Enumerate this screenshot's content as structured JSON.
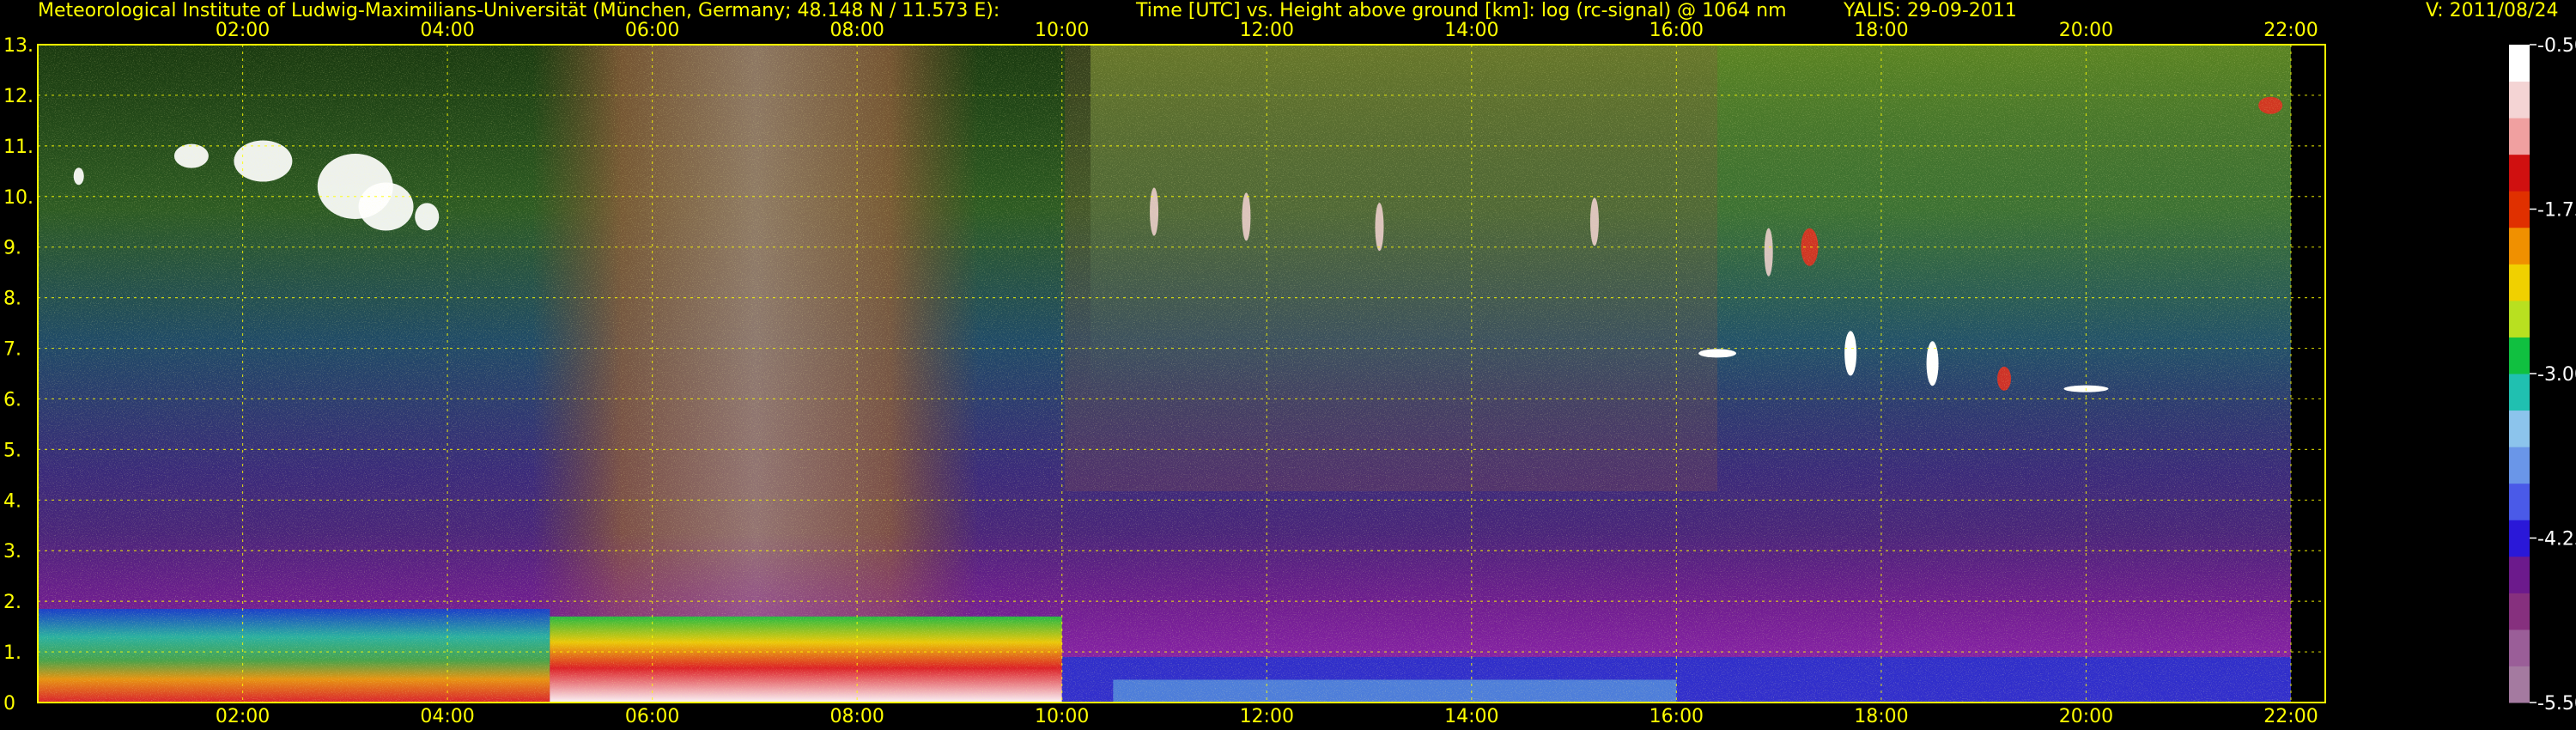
{
  "header": {
    "institute": "Meteorological Institute of Ludwig-Maximilians-Universität (München, Germany; 48.148 N / 11.573 E):",
    "plot_desc": "Time [UTC] vs. Height above ground [km]: log (rc-signal) @ 1064 nm",
    "instrument_date": "YALIS: 29-09-2011",
    "version": "V: 2011/08/24"
  },
  "colors": {
    "text": "#ffff00",
    "grid": "#ffff00",
    "background": "#000000"
  },
  "chart_data": {
    "type": "heatmap",
    "xlabel": "Time [UTC]",
    "ylabel": "Height above ground [km]",
    "x_ticks": [
      "02:00",
      "04:00",
      "06:00",
      "08:00",
      "10:00",
      "12:00",
      "14:00",
      "16:00",
      "18:00",
      "20:00",
      "22:00"
    ],
    "x_tick_values": [
      2,
      4,
      6,
      8,
      10,
      12,
      14,
      16,
      18,
      20,
      22
    ],
    "xlim": [
      0,
      22
    ],
    "y_ticks": [
      "0",
      "1.",
      "2.",
      "3.",
      "4.",
      "5.",
      "6.",
      "7.",
      "8.",
      "9.",
      "10.",
      "11.",
      "12.",
      "13."
    ],
    "y_tick_values": [
      0,
      1,
      2,
      3,
      4,
      5,
      6,
      7,
      8,
      9,
      10,
      11,
      12,
      13
    ],
    "ylim": [
      0,
      13
    ],
    "data_end_hour": 22,
    "colorbar": {
      "ticks": [
        "-0.50",
        "-1.75",
        "-3.00",
        "-4.25",
        "-5.50"
      ],
      "tick_values": [
        -0.5,
        -1.75,
        -3.0,
        -4.25,
        -5.5
      ],
      "range": [
        -5.5,
        -0.5
      ],
      "colors": [
        "#a47aa0",
        "#9a5e98",
        "#86307e",
        "#6c1a8c",
        "#2a18d8",
        "#4a5ae8",
        "#6a96e8",
        "#8cc4ec",
        "#20c0b0",
        "#10c040",
        "#b8e020",
        "#f0d000",
        "#f09000",
        "#e03000",
        "#d01010",
        "#f0a0a0",
        "#f4d4d4",
        "#ffffff"
      ]
    },
    "features": [
      {
        "name": "aerosol-boundary-layer",
        "t_start": 0,
        "t_end": 22,
        "h_top_km": 1.8
      },
      {
        "name": "cirrus-clouds",
        "t_start": 1.2,
        "t_end": 4.2,
        "h_bottom_km": 9.2,
        "h_top_km": 11.2
      },
      {
        "name": "cirrus-fallstreaks",
        "t_start": 10.2,
        "t_end": 15.6,
        "h_bottom_km": 8.5,
        "h_top_km": 10.5
      },
      {
        "name": "mid-level-cloud-layer",
        "t_start": 16.0,
        "t_end": 20.3,
        "h_bottom_km": 6.1,
        "h_top_km": 7.3
      }
    ]
  }
}
